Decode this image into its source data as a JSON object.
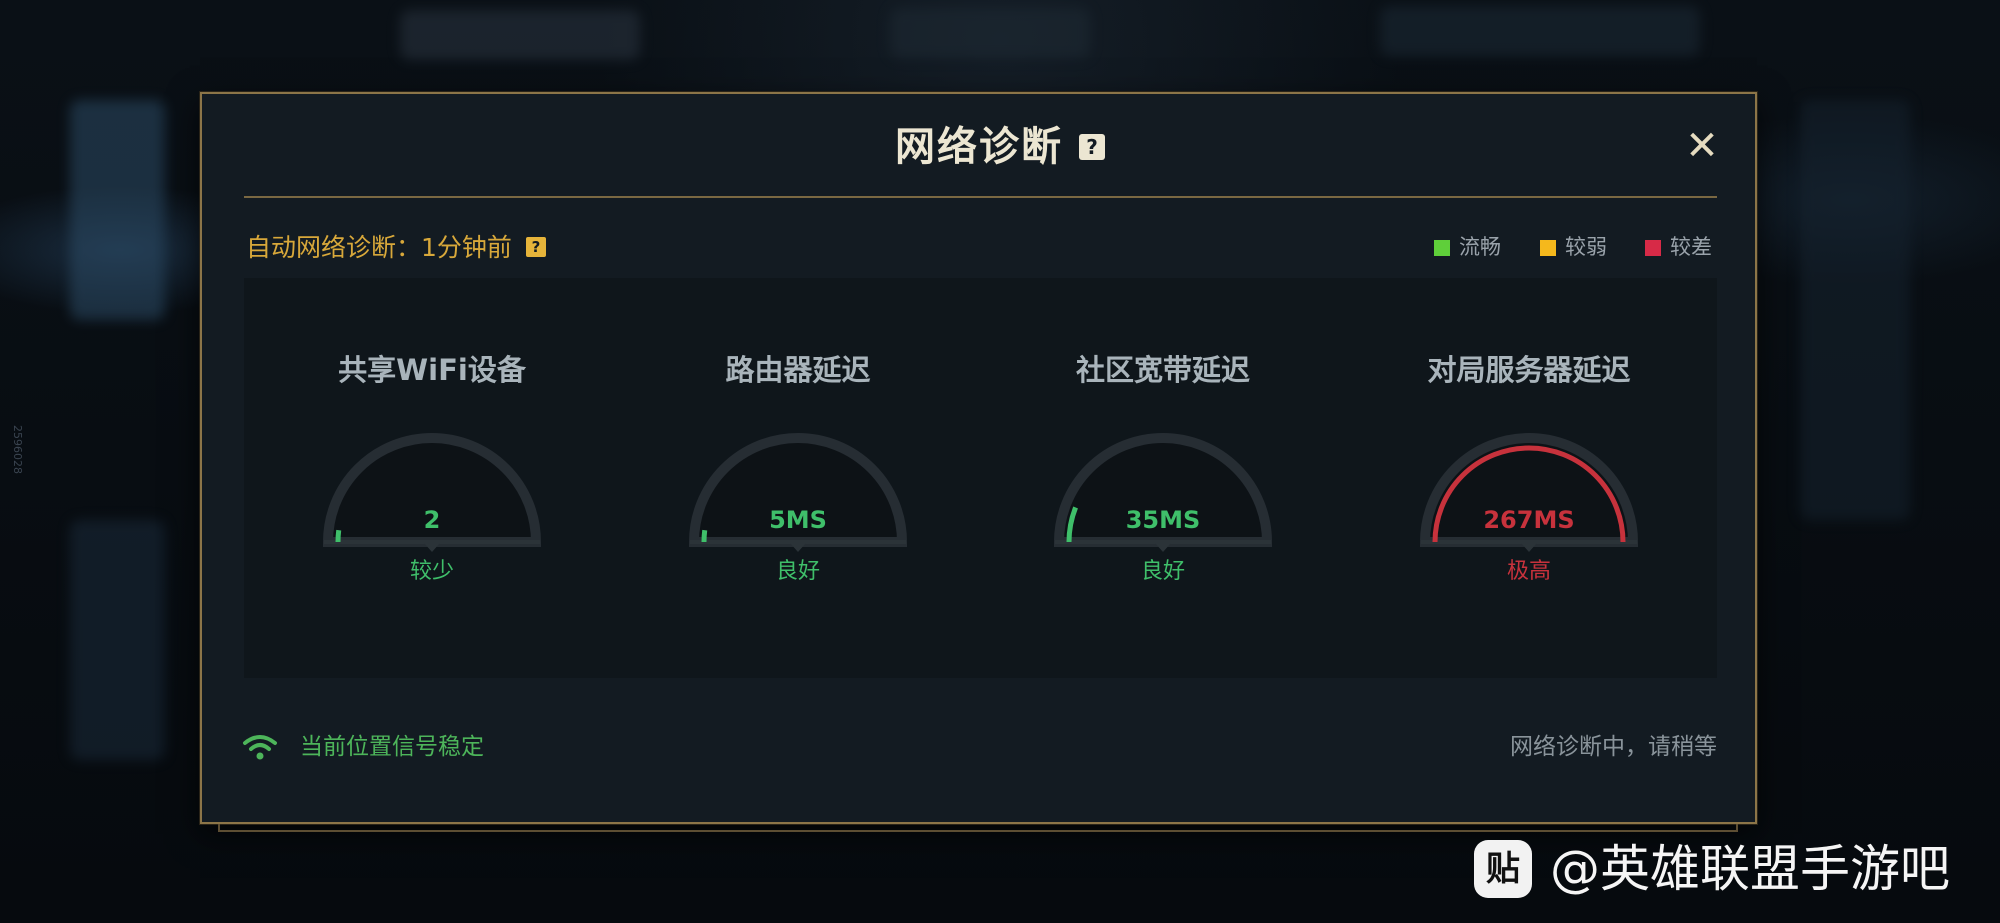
{
  "dialog": {
    "title": "网络诊断",
    "close_glyph": "✕",
    "help_glyph": "?"
  },
  "auto_diagnosis": {
    "label": "自动网络诊断：1分钟前"
  },
  "legend": [
    {
      "label": "流畅",
      "color": "#5fcf3a"
    },
    {
      "label": "较弱",
      "color": "#f5b81c"
    },
    {
      "label": "较差",
      "color": "#d72a47"
    }
  ],
  "metrics": [
    {
      "title": "共享WiFi设备",
      "value": "2",
      "status": "较少",
      "level": 0.04,
      "color": "#3fbf6a"
    },
    {
      "title": "路由器延迟",
      "value": "5MS",
      "status": "良好",
      "level": 0.04,
      "color": "#3fbf6a"
    },
    {
      "title": "社区宽带延迟",
      "value": "35MS",
      "status": "良好",
      "level": 0.12,
      "color": "#3fbf6a"
    },
    {
      "title": "对局服务器延迟",
      "value": "267MS",
      "status": "极高",
      "level": 1.0,
      "color": "#c7323c"
    }
  ],
  "footer": {
    "signal_text": "当前位置信号稳定",
    "status_text": "网络诊断中，请稍等"
  },
  "watermark": {
    "logo_glyph": "贴",
    "text": "@英雄联盟手游吧"
  },
  "side_id": "2596028"
}
